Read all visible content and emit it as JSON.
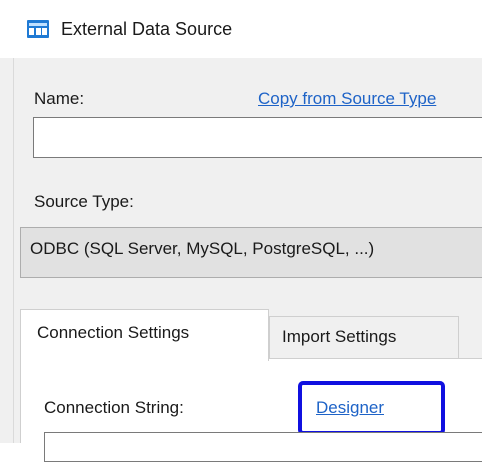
{
  "window": {
    "title": "External Data Source",
    "icon": "external-data-table-icon"
  },
  "form": {
    "name_label": "Name:",
    "copy_link": "Copy from Source Type",
    "name_value": "",
    "source_type_label": "Source Type:",
    "source_type_value": "ODBC (SQL Server, MySQL, PostgreSQL, ...)"
  },
  "tabs": [
    {
      "label": "Connection Settings",
      "selected": true
    },
    {
      "label": "Import Settings",
      "selected": false
    }
  ],
  "connection": {
    "connection_string_label": "Connection String:",
    "designer_link": "Designer",
    "connection_string_value": ""
  },
  "colors": {
    "link": "#1e63c7",
    "highlight": "#1010e0",
    "form_background": "#f0f0f0",
    "icon": "#1f7ad4"
  }
}
